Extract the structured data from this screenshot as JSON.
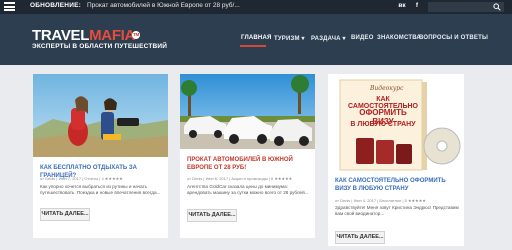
{
  "topbar": {
    "updates_label": "ОБНОВЛЕНИЕ:",
    "news_text": "Прокат автомобилей в Южной Европе от 28 руб/...",
    "social": [
      "вк",
      "f"
    ]
  },
  "header": {
    "logo_part1": "TRAVEL",
    "logo_part2": "MAFIA",
    "logo_badge": "TM",
    "tagline": "ЭКСПЕРТЫ В ОБЛАСТИ ПУТЕШЕСТВИЙ"
  },
  "nav": {
    "items": [
      "ГЛАВНАЯ",
      "ТУРИЗМ ▾",
      "РАЗДАЧА ▾",
      "ВИДЕО",
      "ЗНАКОМСТВА",
      "ВОПРОСЫ И ОТВЕТЫ"
    ]
  },
  "posts": [
    {
      "title": "КАК БЕСПЛАТНО ОТДЫХАТЬ ЗА ГРАНИЦЕЙ?",
      "meta": "от Denis | Июн 7, 2017 | Отчеты | 4 ★★★★★",
      "excerpt": "Как упорно хочется выбраться из рутины и начать путешествовать. Поездка и новые впечатления всегда...",
      "button": "ЧИТАТЬ ДАЛЕЕ...",
      "title_color": "#3a6fb7"
    },
    {
      "title": "ПРОКАТ АВТОМОБИЛЕЙ В ЮЖНОЙ ЕВРОПЕ ОТ 28 РУБ!",
      "meta": "от Denis | Июн 6, 2017 | Акции и промокоды | 6 ★★★★★",
      "excerpt": "Агентство GoldCar сказала цены до минимума: арендовать машину за сутки можно всего от 28 рублей...",
      "button": "ЧИТАТЬ ДАЛЕЕ...",
      "title_color": "#c0392b"
    },
    {
      "title": "КАК САМОСТОЯТЕЛЬНО ОФОРМИТЬ ВИЗУ В ЛЮБУЮ СТРАНУ",
      "meta": "от Denis | Июн 4, 2017 | Бесплатное | 5 ★★★★★",
      "excerpt": "Здравствуйте! Меня зовут Кристина Эндрюс! Представим вам свой виодинатор...",
      "button": "ЧИТАТЬ ДАЛЕЕ...",
      "title_color": "#3a6fb7"
    }
  ],
  "book": {
    "subtitle": "Видеокурс",
    "title_lines": [
      "КАК САМОСТОЯТЕЛЬНО",
      "ОФОРМИТЬ ВИЗУ",
      "В ЛЮБУЮ СТРАНУ"
    ]
  },
  "colors": {
    "topbar_bg": "#1e2732",
    "header_bg": "#2c3e50",
    "accent": "#d74937",
    "link": "#3a6fb7"
  }
}
